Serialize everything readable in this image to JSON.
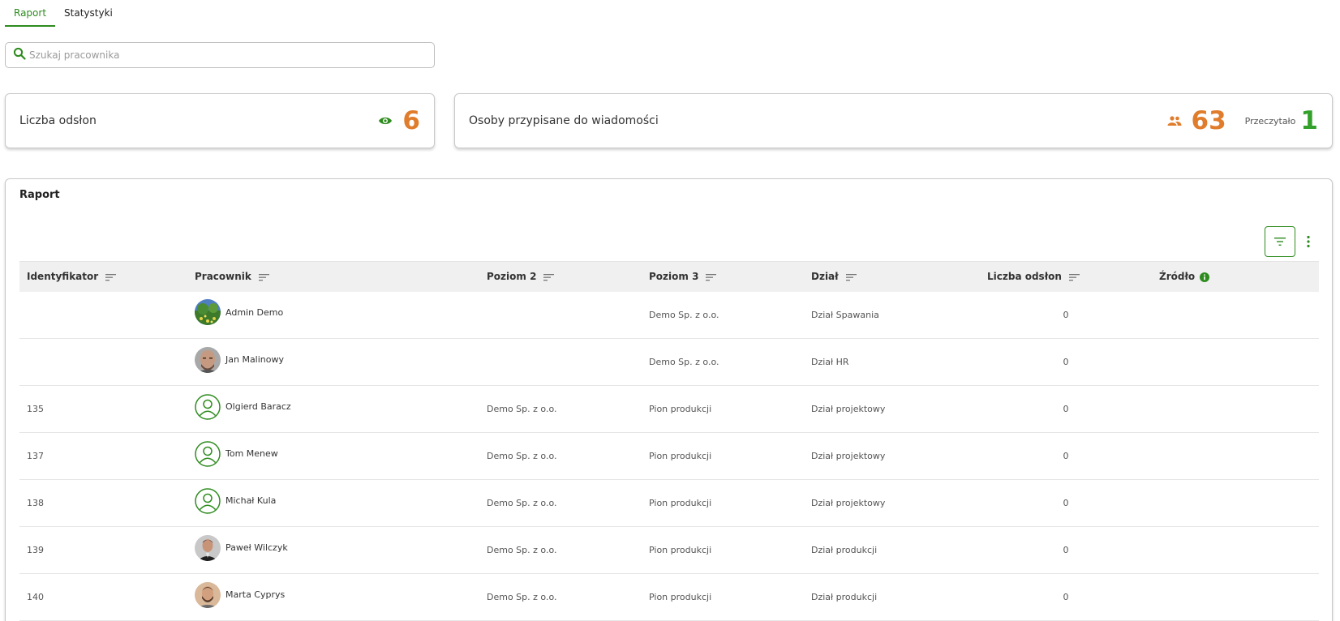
{
  "tabs": [
    {
      "label": "Raport",
      "active": true
    },
    {
      "label": "Statystyki",
      "active": false
    }
  ],
  "search": {
    "placeholder": "Szukaj pracownika",
    "value": ""
  },
  "stats": {
    "views": {
      "label": "Liczba odsłon",
      "icon": "eye-icon",
      "value": "6"
    },
    "assigned": {
      "label": "Osoby przypisane do wiadomości",
      "icon": "people-icon",
      "value": "63",
      "read_label": "Przeczytało",
      "read_value": "1"
    }
  },
  "report": {
    "title": "Raport",
    "columns": [
      "Identyfikator",
      "Pracownik",
      "Poziom 2",
      "Poziom 3",
      "Dział",
      "Liczba odsłon",
      "Źródło"
    ],
    "rows": [
      {
        "id": "",
        "name": "Admin Demo",
        "avatar": "photo-landscape",
        "level2": "",
        "level3": "Demo Sp. z o.o.",
        "dept": "Dział Spawania",
        "views": "0"
      },
      {
        "id": "",
        "name": "Jan Malinowy",
        "avatar": "photo-man-bald",
        "level2": "",
        "level3": "Demo Sp. z o.o.",
        "dept": "Dział HR",
        "views": "0"
      },
      {
        "id": "135",
        "name": "Olgierd Baracz",
        "avatar": "default-user",
        "level2": "Demo Sp. z o.o.",
        "level3": "Pion produkcji",
        "dept": "Dział projektowy",
        "views": "0"
      },
      {
        "id": "137",
        "name": "Tom Menew",
        "avatar": "default-user",
        "level2": "Demo Sp. z o.o.",
        "level3": "Pion produkcji",
        "dept": "Dział projektowy",
        "views": "0"
      },
      {
        "id": "138",
        "name": "Michał Kula",
        "avatar": "default-user",
        "level2": "Demo Sp. z o.o.",
        "level3": "Pion produkcji",
        "dept": "Dział projektowy",
        "views": "0"
      },
      {
        "id": "139",
        "name": "Paweł Wilczyk",
        "avatar": "photo-man-dark",
        "level2": "Demo Sp. z o.o.",
        "level3": "Pion produkcji",
        "dept": "Dział produkcji",
        "views": "0"
      },
      {
        "id": "140",
        "name": "Marta Cyprys",
        "avatar": "photo-man-beard",
        "level2": "Demo Sp. z o.o.",
        "level3": "Pion produkcji",
        "dept": "Dział produkcji",
        "views": "0"
      }
    ]
  },
  "colors": {
    "accent": "#2e8b1e",
    "number_orange": "#e07d2c",
    "number_green": "#33a02c"
  }
}
